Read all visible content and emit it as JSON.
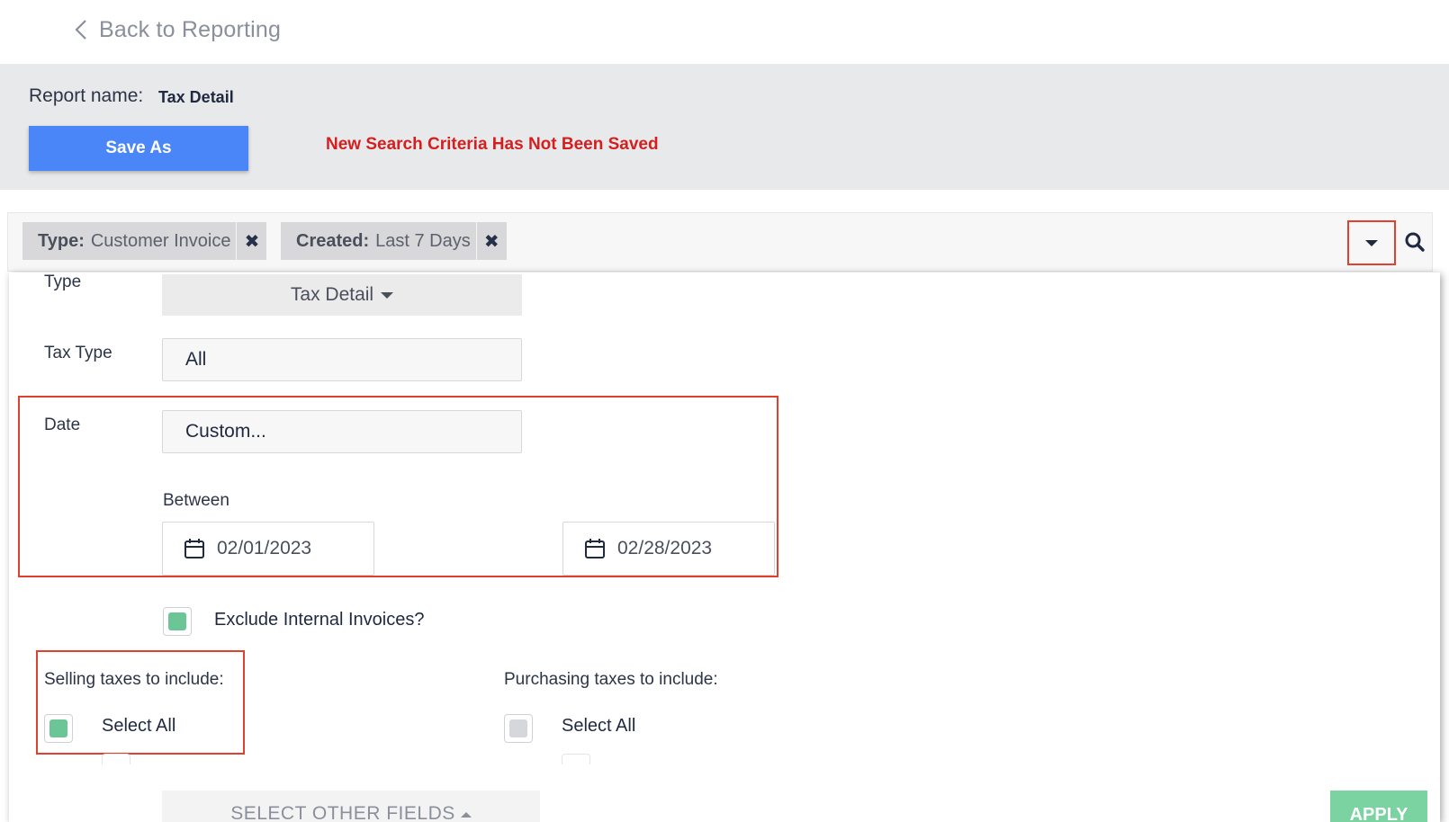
{
  "nav": {
    "back_label": "Back to Reporting"
  },
  "report": {
    "name_label": "Report name:",
    "name_value": "Tax Detail",
    "save_as_label": "Save As",
    "unsaved_message": "New Search Criteria Has Not Been Saved"
  },
  "filters": {
    "chips": [
      {
        "key": "Type:",
        "value": "Customer Invoice"
      },
      {
        "key": "Created:",
        "value": "Last 7 Days"
      }
    ],
    "remove_glyph": "✖"
  },
  "form": {
    "type_label": "Type",
    "type_value": "Tax Detail",
    "tax_type_label": "Tax Type",
    "tax_type_value": "All",
    "date_label": "Date",
    "date_value": "Custom...",
    "between_label": "Between",
    "date_from": "02/01/2023",
    "date_to": "02/28/2023",
    "exclude_internal_label": "Exclude Internal Invoices?",
    "exclude_internal_checked": true,
    "selling_label": "Selling taxes to include:",
    "selling_select_all": "Select All",
    "selling_select_all_checked": true,
    "purchasing_label": "Purchasing taxes to include:",
    "purchasing_select_all": "Select All",
    "purchasing_select_all_checked": false,
    "other_fields_label": "SELECT OTHER FIELDS",
    "apply_label": "APPLY"
  },
  "colors": {
    "primary": "#4a86f7",
    "warning_text": "#d51f1f",
    "highlight": "#e0412f",
    "checked": "#6cc596",
    "unchecked": "#d6d7db",
    "apply": "#7bd3a1"
  },
  "icons": [
    "chevron-left-icon",
    "close-icon",
    "caret-down-icon",
    "search-icon",
    "calendar-icon",
    "caret-up-icon"
  ]
}
